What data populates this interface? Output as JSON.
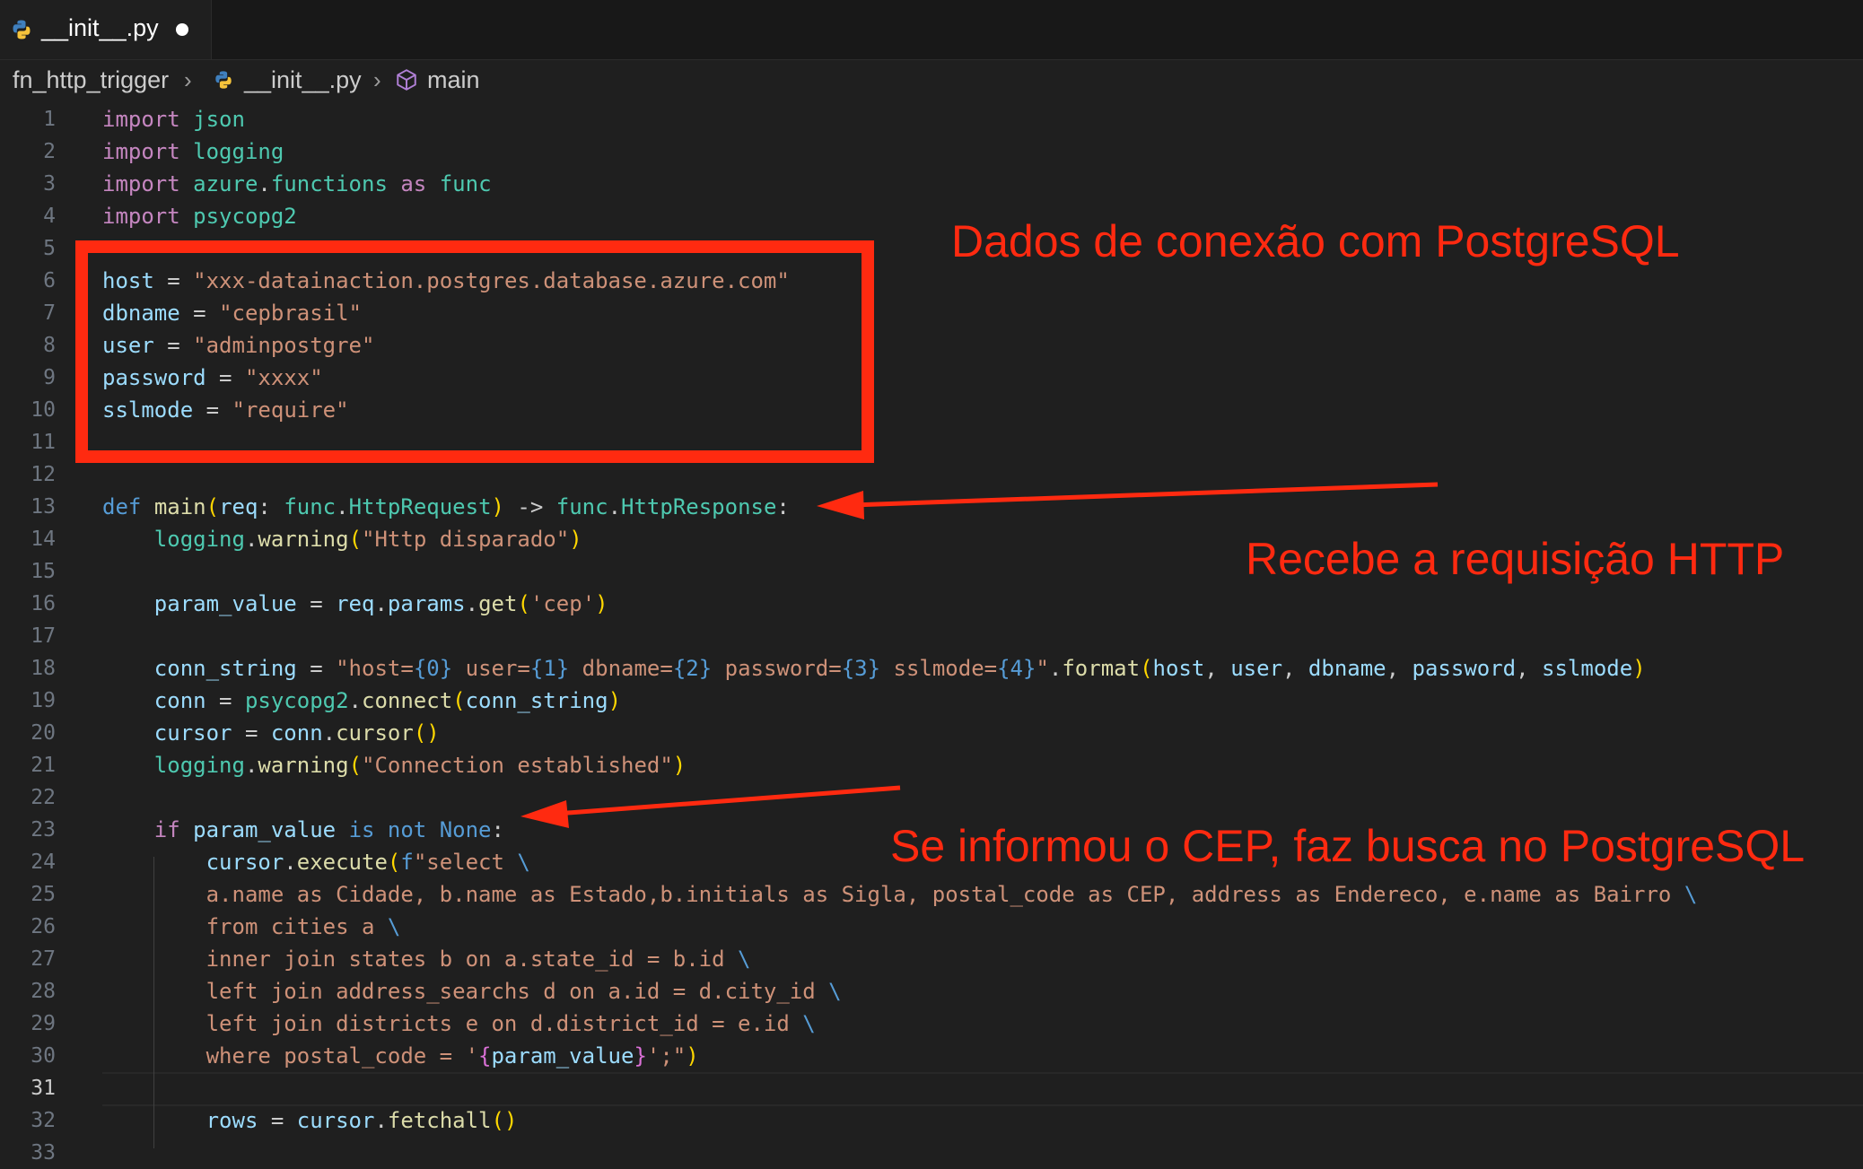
{
  "tab": {
    "label": "__init__.py"
  },
  "breadcrumb": {
    "folder": "fn_http_trigger",
    "file": "__init__.py",
    "symbol": "main"
  },
  "editor": {
    "current_line": 31,
    "lines": [
      {
        "n": "1",
        "tokens": [
          [
            "kw",
            "import"
          ],
          [
            "p",
            " "
          ],
          [
            "mod",
            "json"
          ]
        ]
      },
      {
        "n": "2",
        "tokens": [
          [
            "kw",
            "import"
          ],
          [
            "p",
            " "
          ],
          [
            "mod",
            "logging"
          ]
        ]
      },
      {
        "n": "3",
        "tokens": [
          [
            "kw",
            "import"
          ],
          [
            "p",
            " "
          ],
          [
            "mod",
            "azure"
          ],
          [
            "p",
            "."
          ],
          [
            "mod",
            "functions"
          ],
          [
            "p",
            " "
          ],
          [
            "kw",
            "as"
          ],
          [
            "p",
            " "
          ],
          [
            "mod",
            "func"
          ]
        ]
      },
      {
        "n": "4",
        "tokens": [
          [
            "kw",
            "import"
          ],
          [
            "p",
            " "
          ],
          [
            "mod",
            "psycopg2"
          ]
        ]
      },
      {
        "n": "5",
        "tokens": []
      },
      {
        "n": "6",
        "tokens": [
          [
            "var",
            "host"
          ],
          [
            "p",
            " = "
          ],
          [
            "str",
            "\"xxx-datainaction.postgres.database.azure.com\""
          ]
        ]
      },
      {
        "n": "7",
        "tokens": [
          [
            "var",
            "dbname"
          ],
          [
            "p",
            " = "
          ],
          [
            "str",
            "\"cepbrasil\""
          ]
        ]
      },
      {
        "n": "8",
        "tokens": [
          [
            "var",
            "user"
          ],
          [
            "p",
            " = "
          ],
          [
            "str",
            "\"adminpostgre\""
          ]
        ]
      },
      {
        "n": "9",
        "tokens": [
          [
            "var",
            "password"
          ],
          [
            "p",
            " = "
          ],
          [
            "str",
            "\"xxxx\""
          ]
        ]
      },
      {
        "n": "10",
        "tokens": [
          [
            "var",
            "sslmode"
          ],
          [
            "p",
            " = "
          ],
          [
            "str",
            "\"require\""
          ]
        ]
      },
      {
        "n": "11",
        "tokens": []
      },
      {
        "n": "12",
        "tokens": []
      },
      {
        "n": "13",
        "tokens": [
          [
            "df",
            "def"
          ],
          [
            "p",
            " "
          ],
          [
            "fn",
            "main"
          ],
          [
            "br1",
            "("
          ],
          [
            "var",
            "req"
          ],
          [
            "p",
            ": "
          ],
          [
            "mod",
            "func"
          ],
          [
            "p",
            "."
          ],
          [
            "mod",
            "HttpRequest"
          ],
          [
            "br1",
            ")"
          ],
          [
            "p",
            " -> "
          ],
          [
            "mod",
            "func"
          ],
          [
            "p",
            "."
          ],
          [
            "mod",
            "HttpResponse"
          ],
          [
            "p",
            ":"
          ]
        ]
      },
      {
        "n": "14",
        "tokens": [
          [
            "p",
            "    "
          ],
          [
            "mod",
            "logging"
          ],
          [
            "p",
            "."
          ],
          [
            "fn",
            "warning"
          ],
          [
            "br1",
            "("
          ],
          [
            "str",
            "\"Http disparado\""
          ],
          [
            "br1",
            ")"
          ]
        ]
      },
      {
        "n": "15",
        "tokens": []
      },
      {
        "n": "16",
        "tokens": [
          [
            "p",
            "    "
          ],
          [
            "var",
            "param_value"
          ],
          [
            "p",
            " = "
          ],
          [
            "var",
            "req"
          ],
          [
            "p",
            "."
          ],
          [
            "var",
            "params"
          ],
          [
            "p",
            "."
          ],
          [
            "fn",
            "get"
          ],
          [
            "br1",
            "("
          ],
          [
            "str",
            "'cep'"
          ],
          [
            "br1",
            ")"
          ]
        ]
      },
      {
        "n": "17",
        "tokens": []
      },
      {
        "n": "18",
        "tokens": [
          [
            "p",
            "    "
          ],
          [
            "var",
            "conn_string"
          ],
          [
            "p",
            " = "
          ],
          [
            "str",
            "\"host="
          ],
          [
            "df",
            "{0}"
          ],
          [
            "str",
            " user="
          ],
          [
            "df",
            "{1}"
          ],
          [
            "str",
            " dbname="
          ],
          [
            "df",
            "{2}"
          ],
          [
            "str",
            " password="
          ],
          [
            "df",
            "{3}"
          ],
          [
            "str",
            " sslmode="
          ],
          [
            "df",
            "{4}"
          ],
          [
            "str",
            "\""
          ],
          [
            "p",
            "."
          ],
          [
            "fn",
            "format"
          ],
          [
            "br1",
            "("
          ],
          [
            "var",
            "host"
          ],
          [
            "p",
            ", "
          ],
          [
            "var",
            "user"
          ],
          [
            "p",
            ", "
          ],
          [
            "var",
            "dbname"
          ],
          [
            "p",
            ", "
          ],
          [
            "var",
            "password"
          ],
          [
            "p",
            ", "
          ],
          [
            "var",
            "sslmode"
          ],
          [
            "br1",
            ")"
          ]
        ]
      },
      {
        "n": "19",
        "tokens": [
          [
            "p",
            "    "
          ],
          [
            "var",
            "conn"
          ],
          [
            "p",
            " = "
          ],
          [
            "mod",
            "psycopg2"
          ],
          [
            "p",
            "."
          ],
          [
            "fn",
            "connect"
          ],
          [
            "br1",
            "("
          ],
          [
            "var",
            "conn_string"
          ],
          [
            "br1",
            ")"
          ]
        ]
      },
      {
        "n": "20",
        "tokens": [
          [
            "p",
            "    "
          ],
          [
            "var",
            "cursor"
          ],
          [
            "p",
            " = "
          ],
          [
            "var",
            "conn"
          ],
          [
            "p",
            "."
          ],
          [
            "fn",
            "cursor"
          ],
          [
            "br1",
            "()"
          ]
        ]
      },
      {
        "n": "21",
        "tokens": [
          [
            "p",
            "    "
          ],
          [
            "mod",
            "logging"
          ],
          [
            "p",
            "."
          ],
          [
            "fn",
            "warning"
          ],
          [
            "br1",
            "("
          ],
          [
            "str",
            "\"Connection established\""
          ],
          [
            "br1",
            ")"
          ]
        ]
      },
      {
        "n": "22",
        "tokens": []
      },
      {
        "n": "23",
        "tokens": [
          [
            "p",
            "    "
          ],
          [
            "kw",
            "if"
          ],
          [
            "p",
            " "
          ],
          [
            "var",
            "param_value"
          ],
          [
            "p",
            " "
          ],
          [
            "df",
            "is not None"
          ],
          [
            "p",
            ":"
          ]
        ]
      },
      {
        "n": "24",
        "tokens": [
          [
            "p",
            "        "
          ],
          [
            "var",
            "cursor"
          ],
          [
            "p",
            "."
          ],
          [
            "fn",
            "execute"
          ],
          [
            "br1",
            "("
          ],
          [
            "df",
            "f"
          ],
          [
            "str",
            "\"select "
          ],
          [
            "df",
            "\\"
          ]
        ]
      },
      {
        "n": "25",
        "tokens": [
          [
            "p",
            "        "
          ],
          [
            "str",
            "a.name as Cidade, b.name as Estado,b.initials as Sigla, postal_code as CEP, address as Endereco, e.name as Bairro "
          ],
          [
            "df",
            "\\"
          ]
        ]
      },
      {
        "n": "26",
        "tokens": [
          [
            "p",
            "        "
          ],
          [
            "str",
            "from cities a "
          ],
          [
            "df",
            "\\"
          ]
        ]
      },
      {
        "n": "27",
        "tokens": [
          [
            "p",
            "        "
          ],
          [
            "str",
            "inner join states b on a.state_id = b.id "
          ],
          [
            "df",
            "\\"
          ]
        ]
      },
      {
        "n": "28",
        "tokens": [
          [
            "p",
            "        "
          ],
          [
            "str",
            "left join address_searchs d on a.id = d.city_id "
          ],
          [
            "df",
            "\\"
          ]
        ]
      },
      {
        "n": "29",
        "tokens": [
          [
            "p",
            "        "
          ],
          [
            "str",
            "left join districts e on d.district_id = e.id "
          ],
          [
            "df",
            "\\"
          ]
        ]
      },
      {
        "n": "30",
        "tokens": [
          [
            "p",
            "        "
          ],
          [
            "str",
            "where postal_code = '"
          ],
          [
            "br2",
            "{"
          ],
          [
            "var",
            "param_value"
          ],
          [
            "br2",
            "}"
          ],
          [
            "str",
            "';\""
          ],
          [
            "br1",
            ")"
          ]
        ]
      },
      {
        "n": "31",
        "tokens": []
      },
      {
        "n": "32",
        "tokens": [
          [
            "p",
            "        "
          ],
          [
            "var",
            "rows"
          ],
          [
            "p",
            " = "
          ],
          [
            "var",
            "cursor"
          ],
          [
            "p",
            "."
          ],
          [
            "fn",
            "fetchall"
          ],
          [
            "br1",
            "()"
          ]
        ]
      },
      {
        "n": "33",
        "tokens": []
      }
    ]
  },
  "annotations": {
    "connection": "Dados de conexão com PostgreSQL",
    "request": "Recebe a requisição HTTP",
    "search": "Se informou o CEP, faz busca no PostgreSQL"
  },
  "colors": {
    "annotation": "#ff2a10",
    "background": "#1f1f1f"
  }
}
